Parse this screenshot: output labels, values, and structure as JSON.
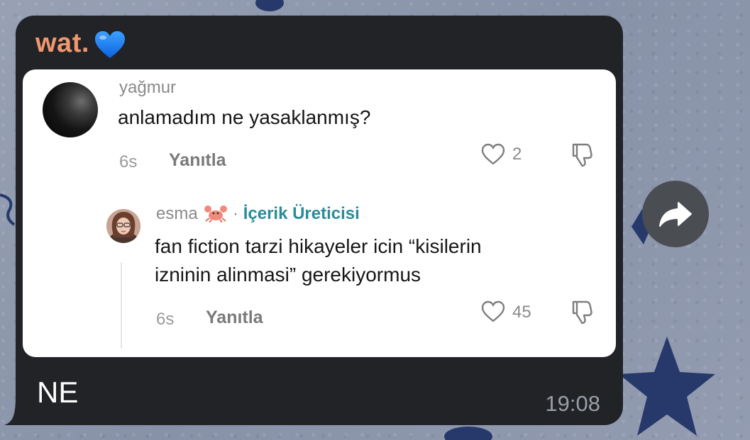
{
  "message": {
    "sender": "wat.",
    "sender_emoji": "blue-heart-emoji",
    "text": "NE",
    "time": "19:08"
  },
  "quoted_comments": [
    {
      "username": "yağmur",
      "text": "anlamadım ne yasaklanmış?",
      "age": "6s",
      "reply_label": "Yanıtla",
      "likes": "2"
    },
    {
      "username": "esma",
      "user_emoji": "crab-emoji",
      "separator": "·",
      "badge": "İçerik Üreticisi",
      "text_line1": "fan fiction tarzi hikayeler icin “kisilerin",
      "text_line2": "izninin alinmasi” gerekiyormus",
      "age": "6s",
      "reply_label": "Yanıtla",
      "likes": "45"
    }
  ],
  "colors": {
    "sender": "#f0976e",
    "bubble": "#212326",
    "creator_badge": "#2b8b9a"
  }
}
